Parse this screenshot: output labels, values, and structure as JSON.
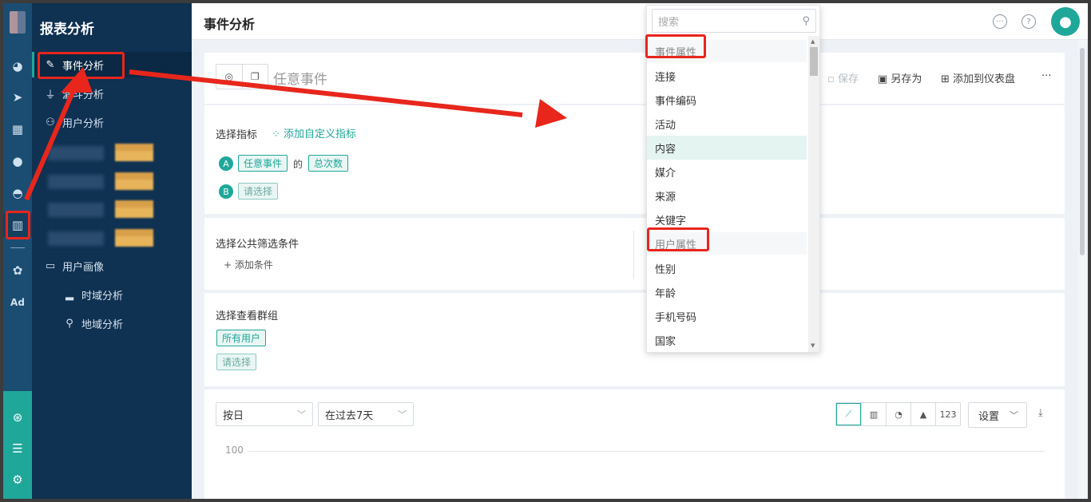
{
  "nav": {
    "title": "报表分析",
    "items": [
      {
        "label": "事件分析",
        "icon": "edit-icon"
      },
      {
        "label": "漏斗分析",
        "icon": "funnel-icon"
      },
      {
        "label": "用户分析",
        "icon": "user-icon"
      },
      {
        "label": "用户画像",
        "icon": "folder-icon"
      },
      {
        "label": "时域分析",
        "icon": "bar-chart-icon"
      },
      {
        "label": "地域分析",
        "icon": "location-icon"
      }
    ]
  },
  "rail": {
    "ad_label": "Ad"
  },
  "header": {
    "title": "事件分析"
  },
  "event_card": {
    "title": "任意事件",
    "save": "保存",
    "save_as": "另存为",
    "add_dashboard": "添加到仪表盘",
    "more": "···"
  },
  "metric_card": {
    "label": "选择指标",
    "add_custom": "添加自定义指标",
    "row_a": {
      "badge": "A",
      "event": "任意事件",
      "of": "的",
      "measure": "总次数"
    },
    "row_b": {
      "badge": "B",
      "placeholder": "请选择"
    }
  },
  "filter_card": {
    "label": "选择公共筛选条件",
    "add": "添加条件"
  },
  "group_card": {
    "label": "选择查看群组",
    "all_users": "所有用户",
    "placeholder": "请选择"
  },
  "chart_card": {
    "granularity": "按日",
    "range": "在过去7天",
    "view_number": "123",
    "settings": "设置",
    "y_tick": "100"
  },
  "dropdown": {
    "search_placeholder": "搜索",
    "group_event": "事件属性",
    "event_items": [
      "连接",
      "事件编码",
      "活动",
      "内容",
      "媒介",
      "来源",
      "关键字"
    ],
    "group_user": "用户属性",
    "user_items": [
      "性别",
      "年龄",
      "手机号码",
      "国家"
    ]
  },
  "colors": {
    "accent": "#1fa79a",
    "nav_bg": "#0f3152",
    "rail_bg": "#1b4d73",
    "annotation": "#e8261c"
  }
}
